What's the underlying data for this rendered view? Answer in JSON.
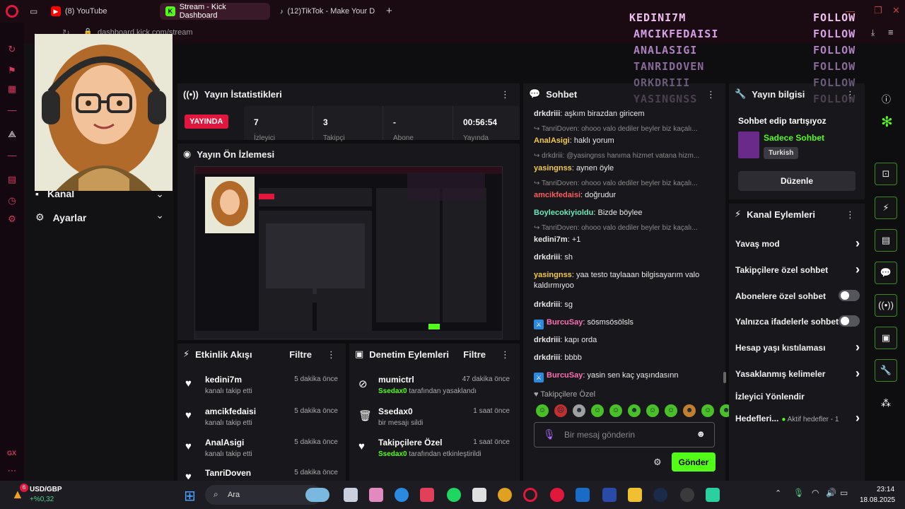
{
  "browser": {
    "tabs": [
      {
        "label": "(8) YouTube"
      },
      {
        "label": "Stream - Kick Dashboard"
      },
      {
        "label": "(12)TikTok - Make Your D"
      }
    ],
    "url": "dashboard.kick.com/stream"
  },
  "nav": {
    "kanal": "Kanal",
    "ayarlar": "Ayarlar"
  },
  "stats": {
    "title": "Yayın İstatistikleri",
    "live": "YAYINDA",
    "items": [
      {
        "value": "7",
        "label": "İzleyici"
      },
      {
        "value": "3",
        "label": "Takipçi"
      },
      {
        "value": "-",
        "label": "Abone"
      },
      {
        "value": "00:56:54",
        "label": "Yayında"
      }
    ]
  },
  "preview": {
    "title": "Yayın Ön İzlemesi"
  },
  "activity": {
    "title": "Etkinlik Akışı",
    "filter": "Filtre",
    "rows": [
      {
        "name": "kedini7m",
        "sub": "kanalı takip etti",
        "time": "5 dakika önce"
      },
      {
        "name": "amcikfedaisi",
        "sub": "kanalı takip etti",
        "time": "5 dakika önce"
      },
      {
        "name": "AnalAsigi",
        "sub": "kanalı takip etti",
        "time": "5 dakika önce"
      },
      {
        "name": "TanriDoven",
        "sub": "",
        "time": "5 dakika önce"
      }
    ]
  },
  "moderation": {
    "title": "Denetim Eylemleri",
    "filter": "Filtre",
    "rows": [
      {
        "name": "mumictrl",
        "actor": "Ssedax0",
        "sub": "tarafından yasaklandı",
        "time": "47 dakika önce"
      },
      {
        "name": "Ssedax0",
        "actor": "",
        "sub": "bir mesajı sildi",
        "time": "1 saat önce"
      },
      {
        "name": "Takipçilere Özel",
        "actor": "Ssedax0",
        "sub": "tarafından etkinleştirildi",
        "time": "1 saat önce"
      }
    ]
  },
  "chat": {
    "title": "Sohbet",
    "messages": [
      {
        "user": "drkdriii",
        "text": "aşkım birazdan giricem",
        "color": "#e8e8e8"
      },
      {
        "reply": "TanriDoven: ohooo valo dediler beyler biz kaçalı..."
      },
      {
        "user": "AnalAsigi",
        "text": "haklı yorum",
        "color": "#f2c94c"
      },
      {
        "reply": "drkdriii: @yasingnss hanıma hizmet vatana hizm..."
      },
      {
        "user": "yasingnss",
        "text": "aynen öyle",
        "color": "#f2c94c"
      },
      {
        "reply": "TanriDoven: ohooo valo dediler beyler biz kaçalı..."
      },
      {
        "user": "amcikfedaisi",
        "text": "doğrudur",
        "color": "#ff5a5a"
      },
      {
        "user": "Boylecokiyioldu",
        "text": "Bizde böylee",
        "color": "#6ee7b7"
      },
      {
        "reply": "TanriDoven: ohooo valo dediler beyler biz kaçalı..."
      },
      {
        "user": "kedini7m",
        "text": "+1",
        "color": "#e8e8e8"
      },
      {
        "user": "drkdriii",
        "text": "sh",
        "color": "#e8e8e8"
      },
      {
        "user": "yasingnss",
        "text": "yaa testo taylaaan bilgisayarım valo kaldırmıyoo",
        "color": "#f2c94c"
      },
      {
        "user": "drkdriii",
        "text": "sg",
        "color": "#e8e8e8"
      },
      {
        "user": "BurcuSay",
        "text": "sösmsösölsls",
        "color": "#ff6fb5"
      },
      {
        "user": "drkdriii",
        "text": "kapı orda",
        "color": "#e8e8e8"
      },
      {
        "user": "drkdriii",
        "text": "bbbb",
        "color": "#e8e8e8"
      },
      {
        "user": "BurcuSay",
        "text": "yasin sen kaç yaşındasınn",
        "color": "#ff6fb5"
      }
    ],
    "followers_only": "Takipçilere Özel",
    "placeholder": "Bir mesaj gönderin",
    "send": "Gönder"
  },
  "stream_info": {
    "title": "Yayın bilgisi",
    "stream_title": "Sohbet edip tartışıyoz",
    "category": "Sadece Sohbet",
    "language": "Turkish",
    "edit": "Düzenle"
  },
  "channel_actions": {
    "title": "Kanal Eylemleri",
    "items": [
      {
        "label": "Yavaş mod",
        "kind": "chevron"
      },
      {
        "label": "Takipçilere özel sohbet",
        "kind": "chevron"
      },
      {
        "label": "Abonelere özel sohbet",
        "kind": "toggle"
      },
      {
        "label": "Yalnızca ifadelerle sohbet",
        "kind": "toggle"
      },
      {
        "label": "Hesap yaşı kıstılaması",
        "kind": "chevron"
      },
      {
        "label": "Yasaklanmış kelimeler",
        "kind": "chevron"
      },
      {
        "label": "İzleyici Yönlendir",
        "kind": "none"
      },
      {
        "label": "Hedefleri...",
        "kind": "chevron"
      }
    ],
    "goals_sub": "Aktif hedefler - 1"
  },
  "overlay": {
    "names": [
      "KEDINI7M",
      "AMCIKFEDAISI",
      "ANALASIGI",
      "TANRIDOVEN",
      "ORKDRIII",
      "YASINGNSS"
    ],
    "follow": "FOLLOW"
  },
  "taskbar": {
    "ticker": "USD/GBP",
    "change": "+%0,32",
    "badge": "6",
    "search": "Ara",
    "time": "23:14",
    "date": "18.08.2025",
    "gx": "GX"
  },
  "colors": {
    "kick_green": "#53fc18",
    "live_red": "#e3173e",
    "opera_red": "#d23a5a"
  }
}
